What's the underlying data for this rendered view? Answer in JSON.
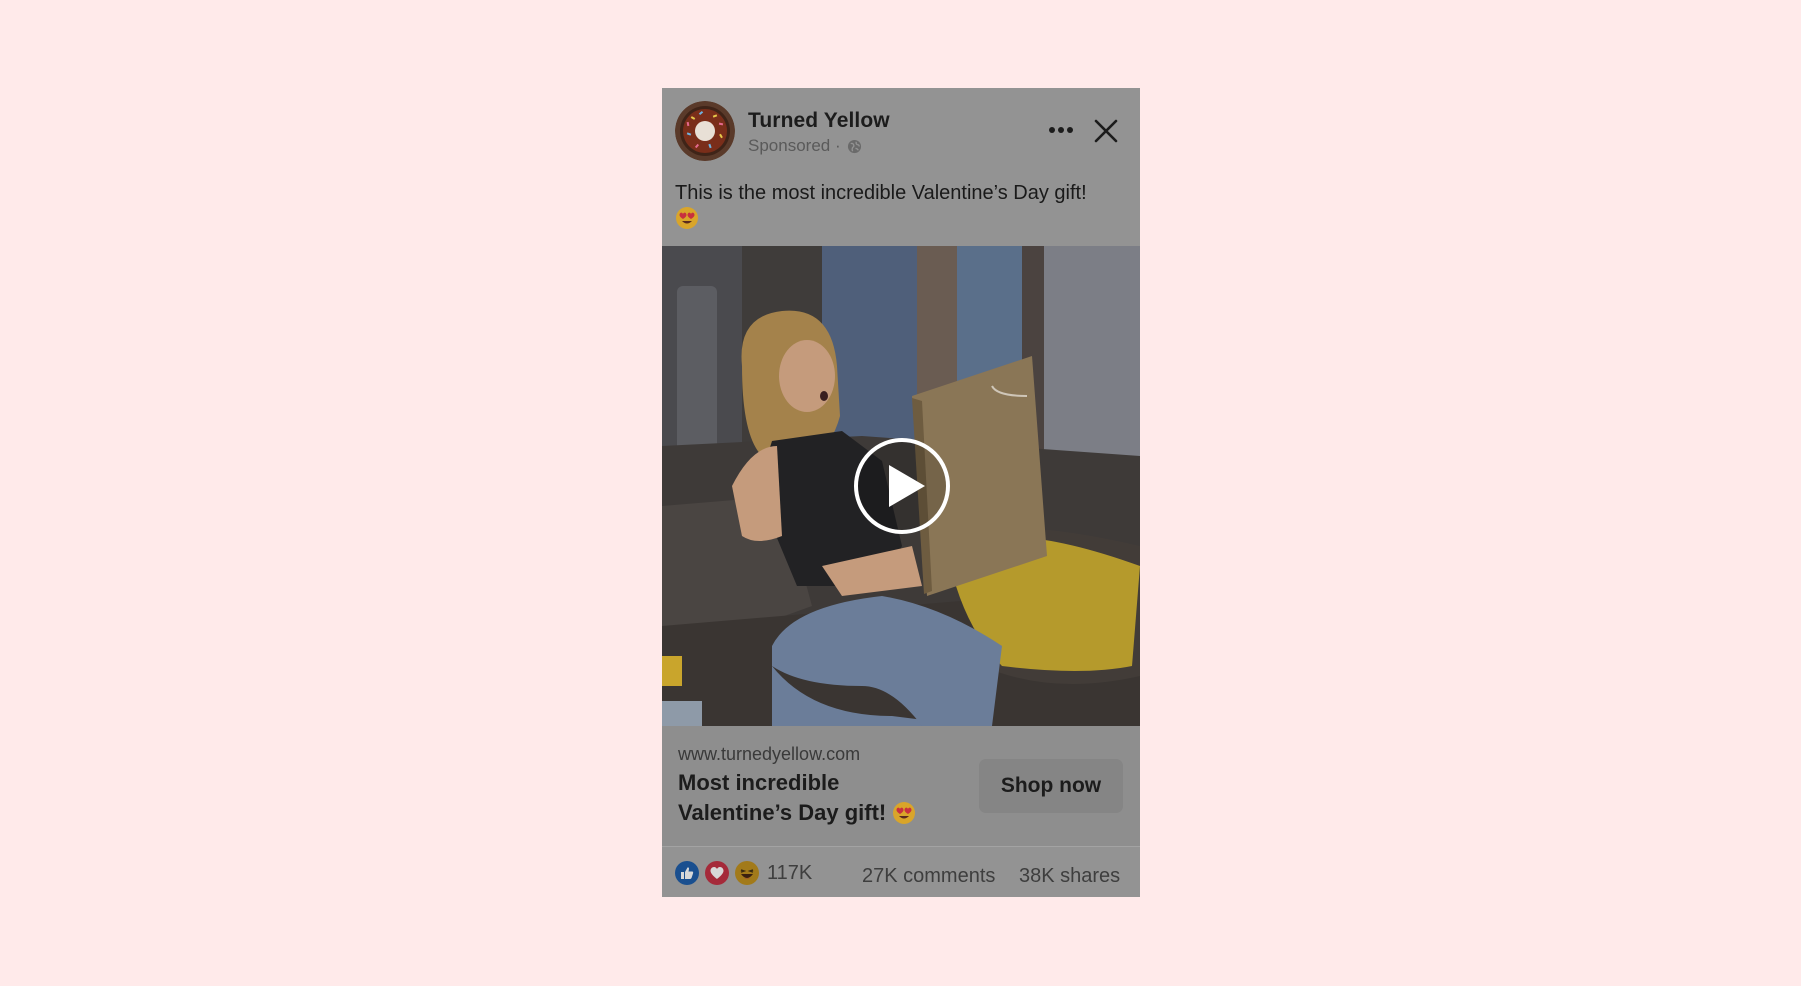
{
  "post": {
    "page_name": "Turned Yellow",
    "sponsored_label": "Sponsored ·",
    "caption": "This is the most incredible Valentine’s Day gift!",
    "media_alt": "Woman on a gray couch opening a gift frame in surprise",
    "link": {
      "domain": "www.turnedyellow.com",
      "headline": "Most incredible Valentine’s Day gift!",
      "cta_label": "Shop now"
    },
    "stats": {
      "reaction_count": "117K",
      "comments": "27K comments",
      "shares": "38K shares"
    },
    "icons": {
      "avatar": "donut-logo-icon",
      "globe": "globe-icon",
      "more": "more-dots-icon",
      "close": "close-icon",
      "play": "play-icon",
      "emoji": "heart-eyes-emoji-icon",
      "reactions": [
        "like-icon",
        "love-icon",
        "haha-icon"
      ]
    },
    "colors": {
      "page_bg": "#ffeaea",
      "like": "#1877f2",
      "love": "#f33e58",
      "haha": "#f7b125"
    }
  }
}
